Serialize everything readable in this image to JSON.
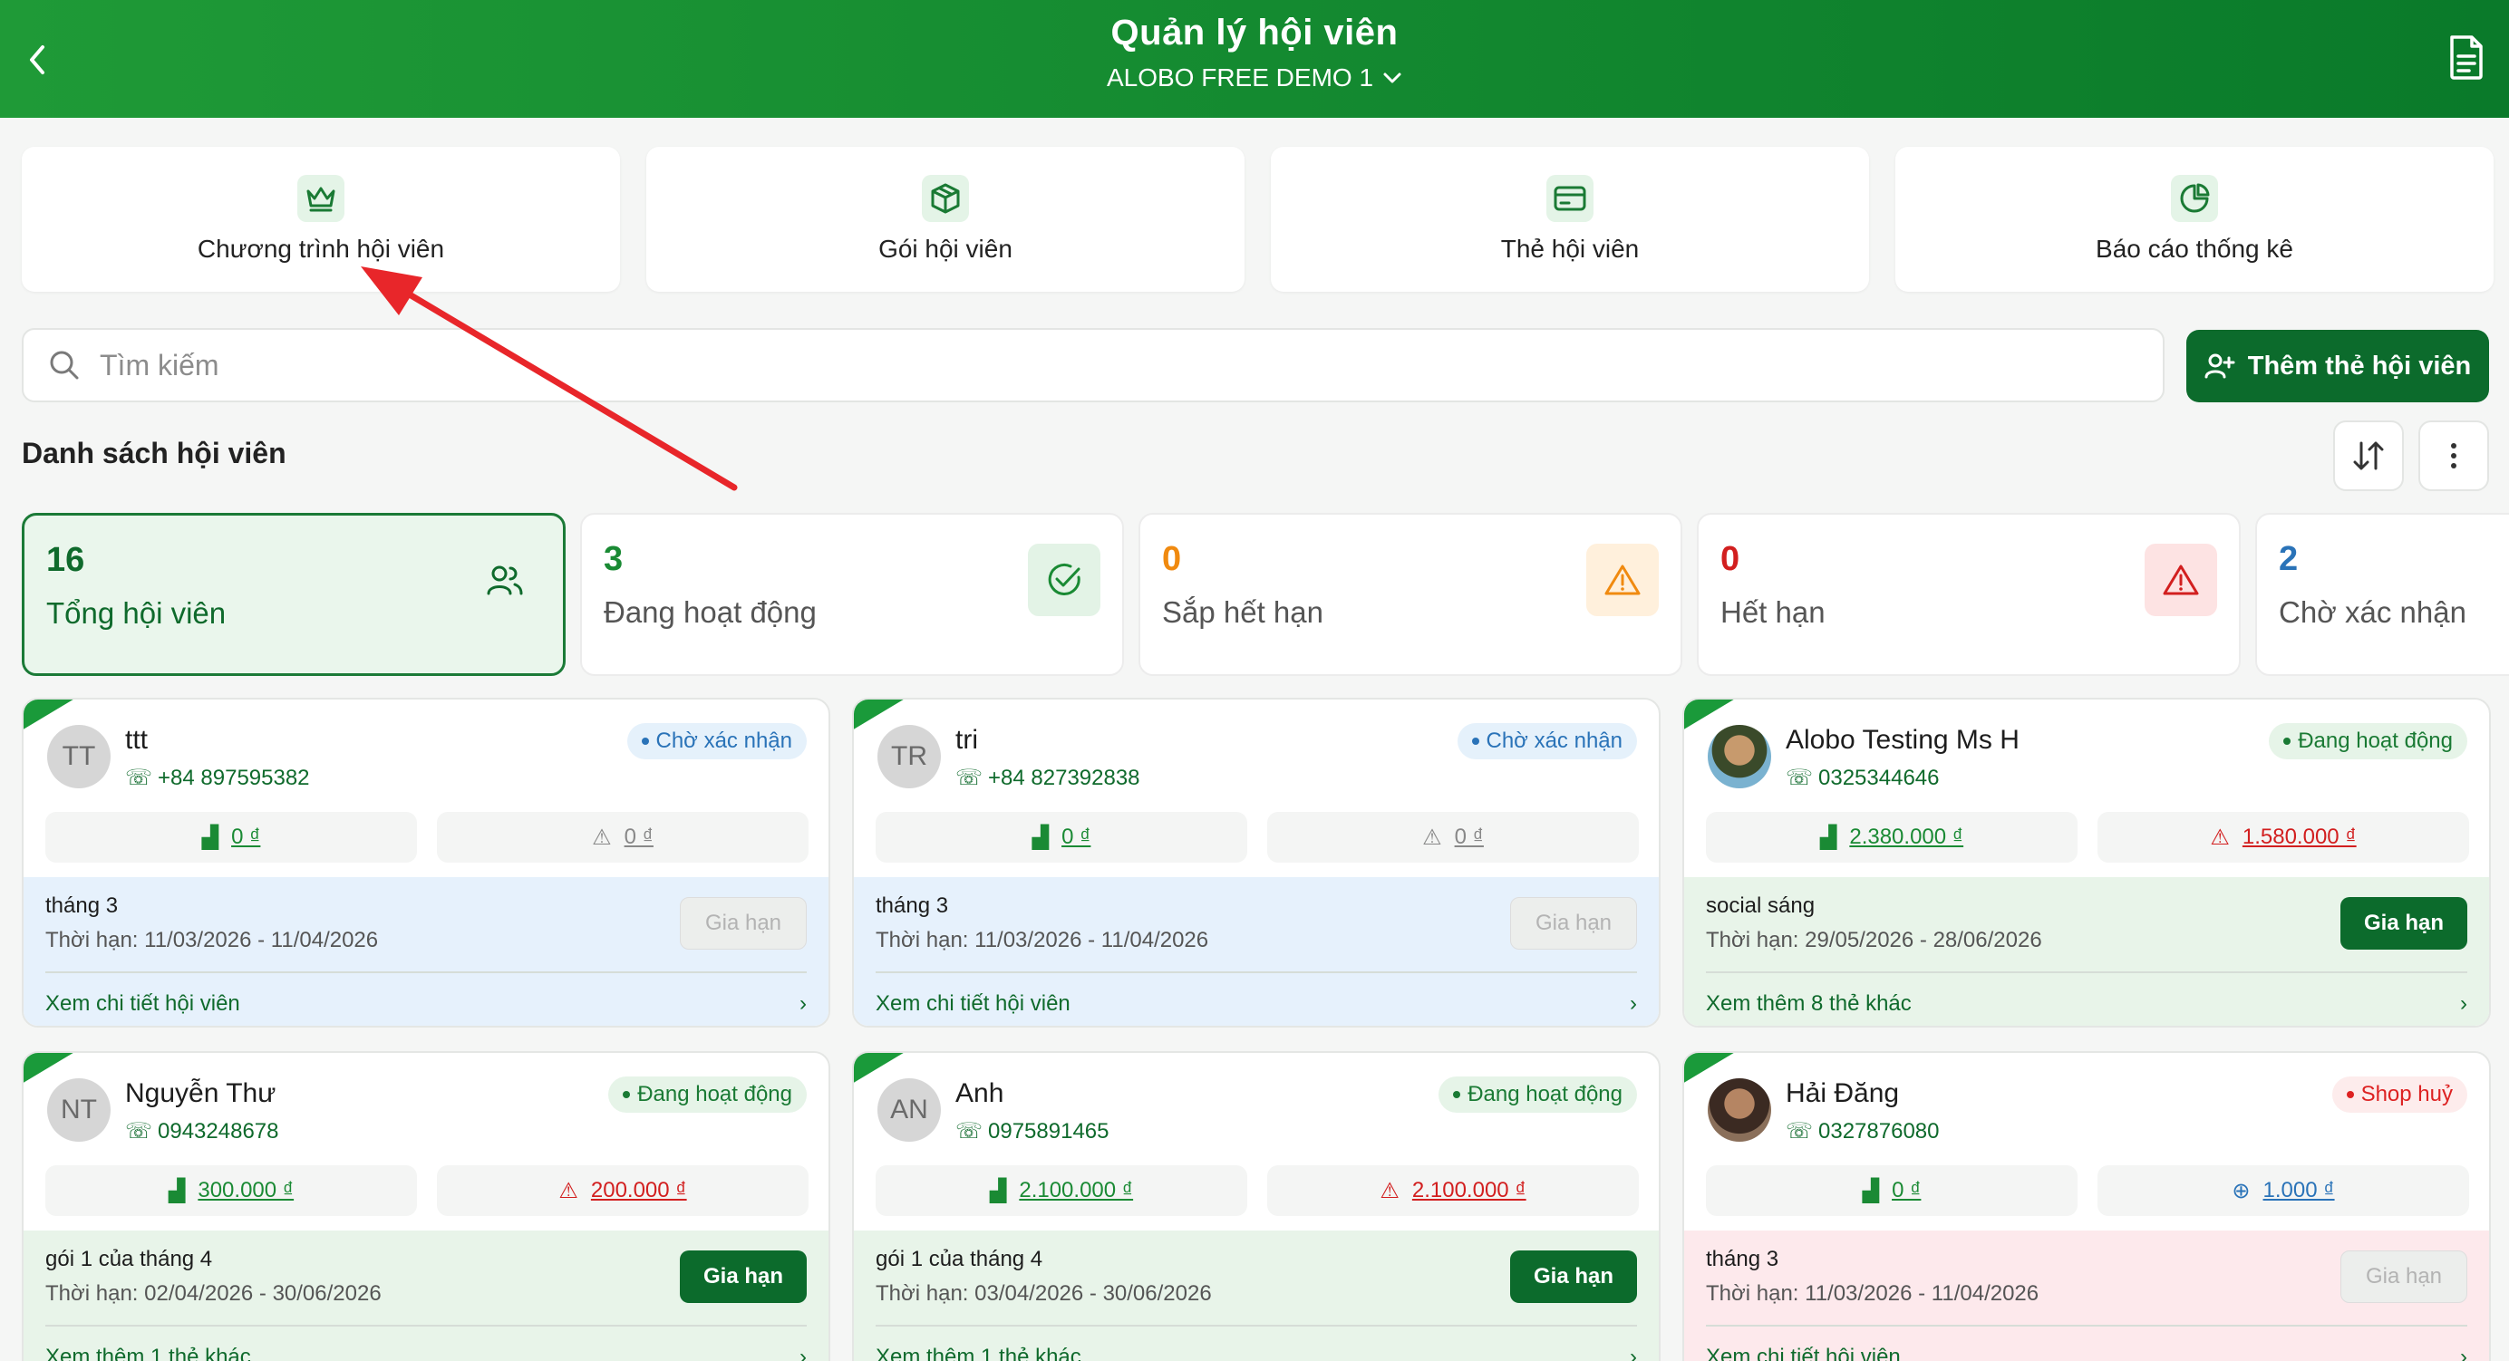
{
  "header": {
    "title": "Quản lý hội viên",
    "subtitle": "ALOBO FREE DEMO 1"
  },
  "tiles": [
    {
      "label": "Chương trình hội viên",
      "icon": "crown-icon"
    },
    {
      "label": "Gói hội viên",
      "icon": "box-icon"
    },
    {
      "label": "Thẻ hội viên",
      "icon": "card-icon"
    },
    {
      "label": "Báo cáo thống kê",
      "icon": "pie-chart-icon"
    }
  ],
  "search": {
    "placeholder": "Tìm kiếm"
  },
  "add_button": "Thêm thẻ hội viên",
  "list_title": "Danh sách hội viên",
  "stats": [
    {
      "value": "16",
      "label": "Tổng hội viên"
    },
    {
      "value": "3",
      "label": "Đang hoạt động"
    },
    {
      "value": "0",
      "label": "Sắp hết hạn"
    },
    {
      "value": "0",
      "label": "Hết hạn"
    },
    {
      "value": "2",
      "label": "Chờ xác nhận"
    }
  ],
  "members": [
    {
      "initials": "TT",
      "name": "ttt",
      "phone": "+84 897595382",
      "status": "Chờ xác nhận",
      "left_amount": "0 ₫",
      "right_amount": "0 ₫",
      "package": "tháng 3",
      "period": "Thời hạn: 11/03/2026 - 11/04/2026",
      "renew": "Gia hạn",
      "more": "Xem chi tiết hội viên"
    },
    {
      "initials": "TR",
      "name": "tri",
      "phone": "+84 827392838",
      "status": "Chờ xác nhận",
      "left_amount": "0 ₫",
      "right_amount": "0 ₫",
      "package": "tháng 3",
      "period": "Thời hạn: 11/03/2026 - 11/04/2026",
      "renew": "Gia hạn",
      "more": "Xem chi tiết hội viên"
    },
    {
      "initials": "",
      "name": "Alobo Testing Ms H",
      "phone": "0325344646",
      "status": "Đang hoạt động",
      "left_amount": "2.380.000 ₫",
      "right_amount": "1.580.000 ₫",
      "package": "social sáng",
      "period": "Thời hạn: 29/05/2026 - 28/06/2026",
      "renew": "Gia hạn",
      "more": "Xem thêm 8 thẻ khác"
    },
    {
      "initials": "NT",
      "name": "Nguyễn Thư",
      "phone": "0943248678",
      "status": "Đang hoạt động",
      "left_amount": "300.000 ₫",
      "right_amount": "200.000 ₫",
      "package": "gói 1 của tháng 4",
      "period": "Thời hạn: 02/04/2026 - 30/06/2026",
      "renew": "Gia hạn",
      "more": "Xem thêm 1 thẻ khác"
    },
    {
      "initials": "AN",
      "name": "Anh",
      "phone": "0975891465",
      "status": "Đang hoạt động",
      "left_amount": "2.100.000 ₫",
      "right_amount": "2.100.000 ₫",
      "package": "gói 1 của tháng 4",
      "period": "Thời hạn: 03/04/2026 - 30/06/2026",
      "renew": "Gia hạn",
      "more": "Xem thêm 1 thẻ khác"
    },
    {
      "initials": "",
      "name": "Hải Đăng",
      "phone": "0327876080",
      "status": "Shop huỷ",
      "left_amount": "0 ₫",
      "right_amount": "1.000 ₫",
      "package": "tháng 3",
      "period": "Thời hạn: 11/03/2026 - 11/04/2026",
      "renew": "Gia hạn",
      "more": "Xem chi tiết hội viên"
    }
  ],
  "colors": {
    "brand": "#0c6b2c",
    "header": "#1a9a3a",
    "annotation_arrow": "#e8262a"
  }
}
